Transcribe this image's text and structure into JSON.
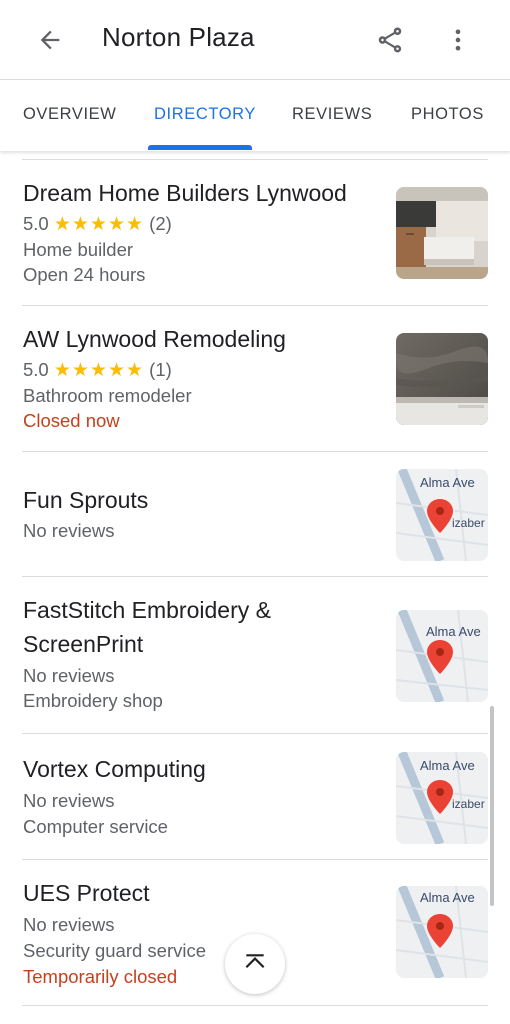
{
  "header": {
    "title": "Norton Plaza",
    "back_icon": "arrow-back-icon",
    "share_icon": "share-icon",
    "more_icon": "more-vert-icon"
  },
  "tabs": [
    {
      "label": "OVERVIEW",
      "active": false
    },
    {
      "label": "DIRECTORY",
      "active": true
    },
    {
      "label": "REVIEWS",
      "active": false
    },
    {
      "label": "PHOTOS",
      "active": false
    }
  ],
  "colors": {
    "accent": "#1a73e8",
    "star": "#fbbc04",
    "closed": "#c5411e",
    "text": "#202124",
    "secondary": "#5f6368"
  },
  "listings": [
    {
      "name": "Dream Home Builders Lynwood",
      "rating": "5.0",
      "stars": "★★★★★",
      "review_count": "(2)",
      "category": "Home builder",
      "status": "Open 24 hours",
      "thumbnail": "kitchen-photo"
    },
    {
      "name": "AW Lynwood Remodeling",
      "rating": "5.0",
      "stars": "★★★★★",
      "review_count": "(1)",
      "category": "Bathroom remodeler",
      "status": "Closed now",
      "thumbnail": "bathroom-photo"
    },
    {
      "name": "Fun Sprouts",
      "reviews": "No reviews",
      "thumbnail": "map-pin-thumbnail",
      "map_labels": [
        "Alma Ave",
        "izaber"
      ]
    },
    {
      "name_line1": "FastStitch Embroidery &",
      "name_line2": "ScreenPrint",
      "reviews": "No reviews",
      "category": "Embroidery shop",
      "thumbnail": "map-pin-thumbnail",
      "map_labels": [
        "Alma Ave"
      ]
    },
    {
      "name": "Vortex Computing",
      "reviews": "No reviews",
      "category": "Computer service",
      "thumbnail": "map-pin-thumbnail",
      "map_labels": [
        "Alma Ave",
        "izaber"
      ]
    },
    {
      "name": "UES Protect",
      "reviews": "No reviews",
      "category": "Security guard service",
      "status": "Temporarily closed",
      "thumbnail": "map-pin-thumbnail",
      "map_labels": [
        "Alma Ave"
      ]
    }
  ],
  "scroll_top_icon": "chevron-up-icon"
}
